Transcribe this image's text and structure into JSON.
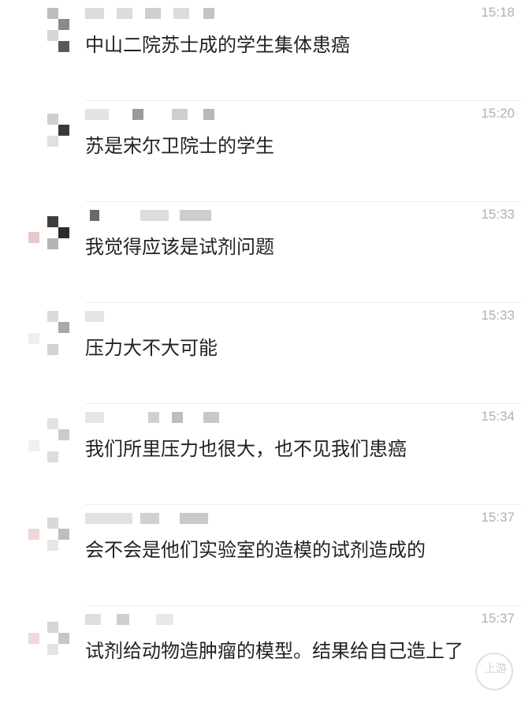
{
  "messages": [
    {
      "time": "15:18",
      "text": "中山二院苏士成的学生集体患癌"
    },
    {
      "time": "15:20",
      "text": "苏是宋尔卫院士的学生"
    },
    {
      "time": "15:33",
      "text": "我觉得应该是试剂问题"
    },
    {
      "time": "15:33",
      "text": "压力大不大可能"
    },
    {
      "time": "15:34",
      "text": "我们所里压力也很大，也不见我们患癌"
    },
    {
      "time": "15:37",
      "text": "会不会是他们实验室的造模的试剂造成的"
    },
    {
      "time": "15:37",
      "text": "试剂给动物造肿瘤的模型。结果给自己造上了"
    }
  ],
  "watermark": {
    "text": "上游"
  }
}
